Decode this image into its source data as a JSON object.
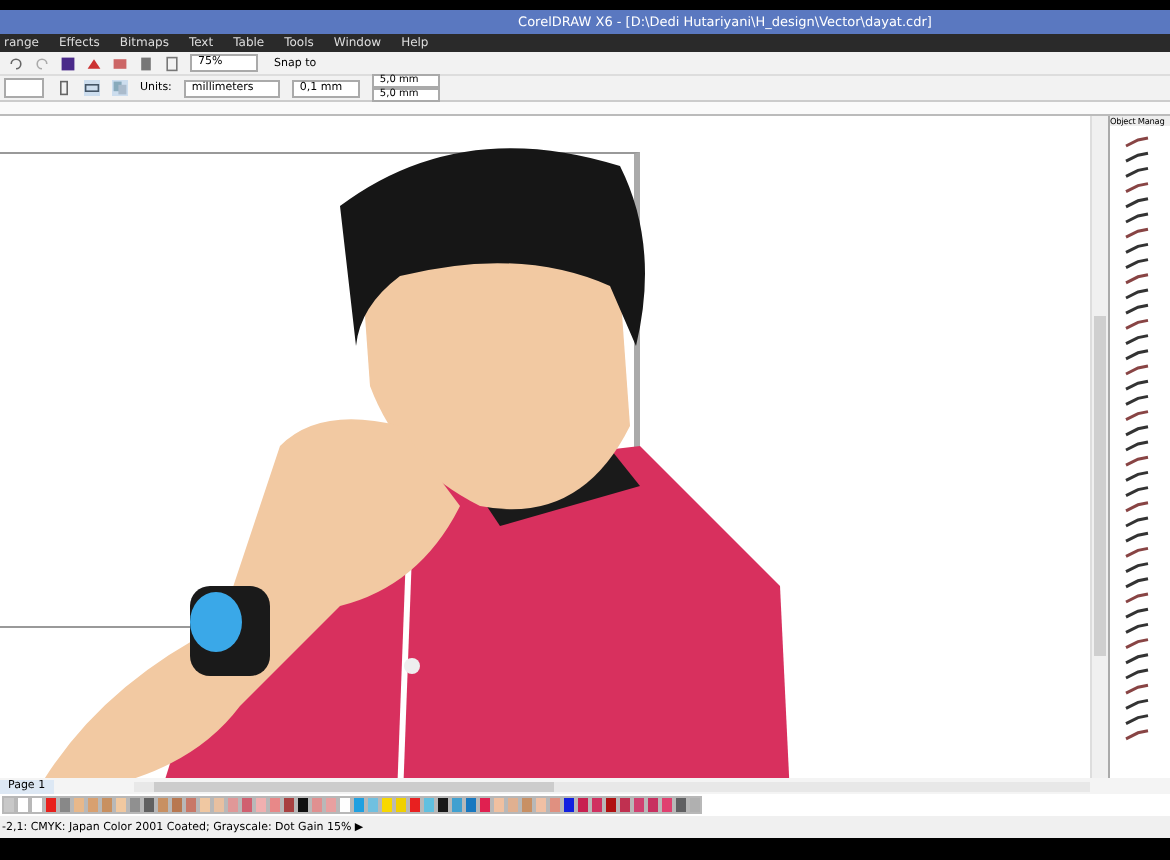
{
  "window": {
    "title": "CorelDRAW X6 - [D:\\Dedi Hutariyani\\H_design\\Vector\\dayat.cdr]"
  },
  "menu": [
    "range",
    "Effects",
    "Bitmaps",
    "Text",
    "Table",
    "Tools",
    "Window",
    "Help"
  ],
  "toolbar": {
    "zoom": "75%",
    "snap": "Snap to"
  },
  "property_bar": {
    "units_label": "Units:",
    "units": "millimeters",
    "nudge": "0,1 mm",
    "dup_x": "5,0 mm",
    "dup_y": "5,0 mm"
  },
  "page_tab": "Page 1",
  "object_manager": {
    "title": "Object Manag"
  },
  "palette": [
    {
      "color": "#c8c8c8"
    },
    {
      "color": "#ffffff"
    },
    {
      "color": "#ffffff"
    },
    {
      "color": "#e8201c"
    },
    {
      "color": "#888888"
    },
    {
      "color": "#e8b88a"
    },
    {
      "color": "#d8a070"
    },
    {
      "color": "#c89060"
    },
    {
      "color": "#f0c8a0"
    },
    {
      "color": "#909090"
    },
    {
      "color": "#606060"
    },
    {
      "color": "#c89062"
    },
    {
      "color": "#b87850"
    },
    {
      "color": "#c87868"
    },
    {
      "color": "#f0c8a2"
    },
    {
      "color": "#e8c0a0"
    },
    {
      "color": "#e09898"
    },
    {
      "color": "#d06070"
    },
    {
      "color": "#f0b0b0"
    },
    {
      "color": "#e88888"
    },
    {
      "color": "#a84040"
    },
    {
      "color": "#101010"
    },
    {
      "color": "#e09090"
    },
    {
      "color": "#e8a0a0"
    },
    {
      "color": "#fefefe"
    },
    {
      "color": "#20a0e0"
    },
    {
      "color": "#70c0e0"
    },
    {
      "color": "#f8d800"
    },
    {
      "color": "#f0d000"
    },
    {
      "color": "#e82020"
    },
    {
      "color": "#60c0e0"
    },
    {
      "color": "#181818"
    },
    {
      "color": "#40a0d0"
    },
    {
      "color": "#1878c0"
    },
    {
      "color": "#e02050"
    },
    {
      "color": "#f0c0a0"
    },
    {
      "color": "#e0b090"
    },
    {
      "color": "#c89064"
    },
    {
      "color": "#f0c0a4"
    },
    {
      "color": "#e09080"
    },
    {
      "color": "#1020e0"
    },
    {
      "color": "#c82050"
    },
    {
      "color": "#d03060"
    },
    {
      "color": "#b01010"
    },
    {
      "color": "#c03050"
    },
    {
      "color": "#d04070"
    },
    {
      "color": "#c83060"
    },
    {
      "color": "#e04070"
    },
    {
      "color": "#606062"
    },
    {
      "color": "#b0b0b0"
    }
  ],
  "status_bar": "-2,1: CMYK: Japan Color 2001 Coated; Grayscale: Dot Gain 15% ▶"
}
